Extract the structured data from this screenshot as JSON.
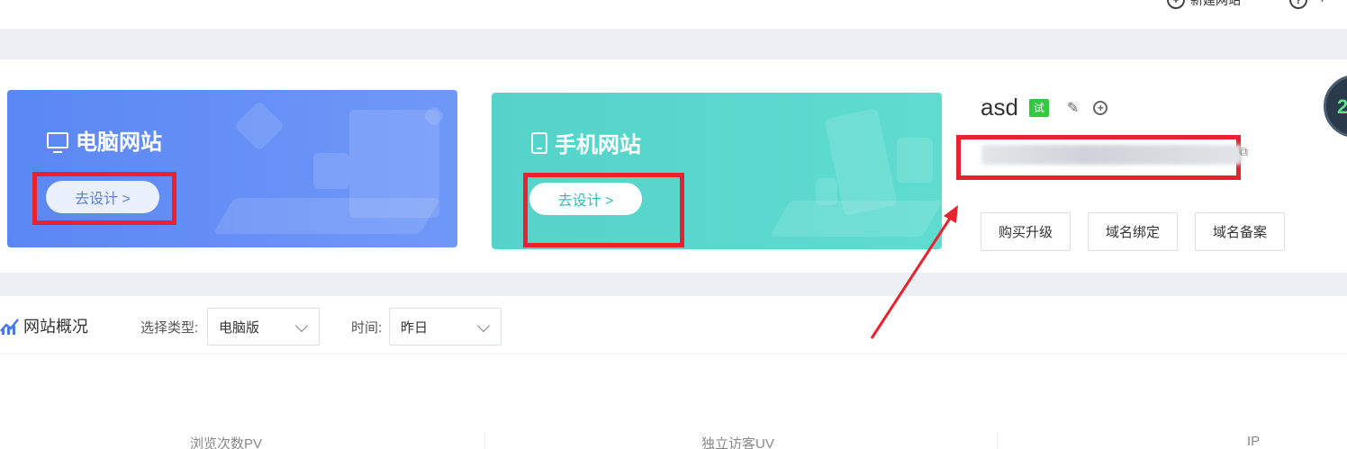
{
  "topbar": {
    "new_site_label": "新建网站",
    "new_site_icon": "plus-circle-icon",
    "help_icon": "question-circle-icon"
  },
  "cards": {
    "pc": {
      "title": "电脑网站",
      "icon": "monitor-icon",
      "design_label": "去设计 >",
      "bg_color": "#5b87f4"
    },
    "mobile": {
      "title": "手机网站",
      "icon": "tablet-icon",
      "design_label": "去设计 >",
      "bg_color": "#55d3ca"
    }
  },
  "site": {
    "name": "asd",
    "trial_badge": "试",
    "edit_icon": "edit-icon",
    "add_icon": "plus-circle-icon",
    "copy_icon": "copy-icon"
  },
  "actions": {
    "buy_upgrade": "购买升级",
    "domain_bind": "域名绑定",
    "domain_record": "域名备案"
  },
  "overview": {
    "title": "网站概况",
    "type_label": "选择类型:",
    "type_value": "电脑版",
    "time_label": "时间:",
    "time_value": "昨日"
  },
  "metrics": {
    "pv": "浏览次数PV",
    "uv": "独立访客UV",
    "ip": "IP"
  },
  "annotation_color": "#e8222e"
}
